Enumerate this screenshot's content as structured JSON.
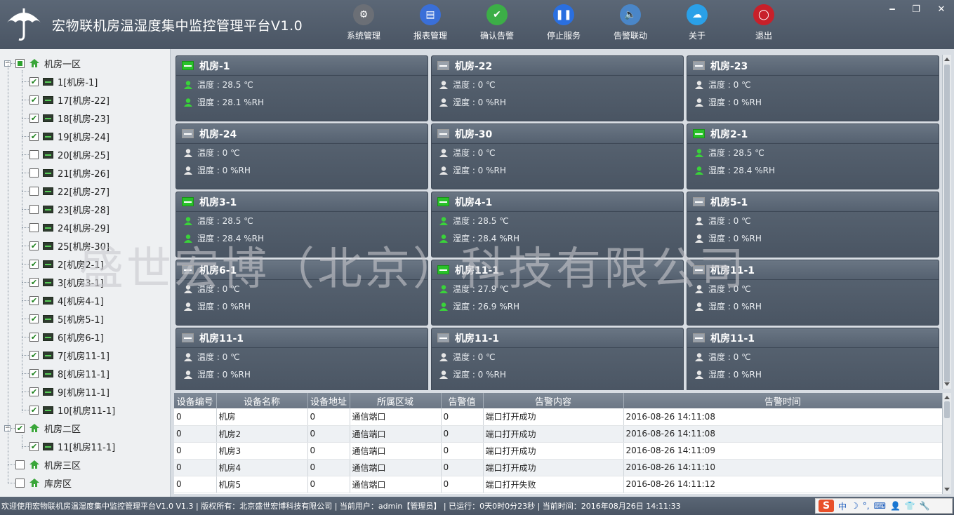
{
  "header": {
    "title": "宏物联机房温湿度集中监控管理平台V1.0",
    "toolbar": [
      {
        "label": "系统管理",
        "icon": "gear-icon",
        "color": "#6b6f76"
      },
      {
        "label": "报表管理",
        "icon": "report-icon",
        "color": "#3a6fd8"
      },
      {
        "label": "确认告警",
        "icon": "check-icon",
        "color": "#3cae47"
      },
      {
        "label": "停止服务",
        "icon": "pause-icon",
        "color": "#2a6fe0"
      },
      {
        "label": "告警联动",
        "icon": "speaker-icon",
        "color": "#4a86c8"
      },
      {
        "label": "关于",
        "icon": "cloud-icon",
        "color": "#2aa0e8"
      },
      {
        "label": "退出",
        "icon": "power-icon",
        "color": "#c8202a"
      }
    ],
    "window_controls": {
      "minimize": "‒",
      "restore": "❐",
      "close": "✕"
    }
  },
  "tree": {
    "groups": [
      {
        "label": "机房一区",
        "state": "partial",
        "children": [
          {
            "label": "1[机房-1]",
            "checked": true
          },
          {
            "label": "17[机房-22]",
            "checked": true
          },
          {
            "label": "18[机房-23]",
            "checked": true
          },
          {
            "label": "19[机房-24]",
            "checked": true
          },
          {
            "label": "20[机房-25]",
            "checked": false
          },
          {
            "label": "21[机房-26]",
            "checked": false
          },
          {
            "label": "22[机房-27]",
            "checked": false
          },
          {
            "label": "23[机房-28]",
            "checked": false
          },
          {
            "label": "24[机房-29]",
            "checked": false
          },
          {
            "label": "25[机房-30]",
            "checked": true
          },
          {
            "label": "2[机房2-1]",
            "checked": true
          },
          {
            "label": "3[机房3-1]",
            "checked": true
          },
          {
            "label": "4[机房4-1]",
            "checked": true
          },
          {
            "label": "5[机房5-1]",
            "checked": true
          },
          {
            "label": "6[机房6-1]",
            "checked": true
          },
          {
            "label": "7[机房11-1]",
            "checked": true
          },
          {
            "label": "8[机房11-1]",
            "checked": true
          },
          {
            "label": "9[机房11-1]",
            "checked": true
          },
          {
            "label": "10[机房11-1]",
            "checked": true
          }
        ]
      },
      {
        "label": "机房二区",
        "state": "checked",
        "children": [
          {
            "label": "11[机房11-1]",
            "checked": true
          }
        ]
      },
      {
        "label": "机房三区",
        "state": "unchecked",
        "children": []
      },
      {
        "label": "库房区",
        "state": "unchecked",
        "children": []
      }
    ]
  },
  "cards": [
    {
      "name": "机房-1",
      "online": true,
      "temp": "温度 : 28.5 ℃",
      "hum": "湿度 : 28.1 %RH"
    },
    {
      "name": "机房-22",
      "online": false,
      "temp": "温度 : 0 ℃",
      "hum": "湿度 : 0 %RH"
    },
    {
      "name": "机房-23",
      "online": false,
      "temp": "温度 : 0 ℃",
      "hum": "湿度 : 0 %RH"
    },
    {
      "name": "机房-24",
      "online": false,
      "temp": "温度 : 0 ℃",
      "hum": "湿度 : 0 %RH"
    },
    {
      "name": "机房-30",
      "online": false,
      "temp": "温度 : 0 ℃",
      "hum": "湿度 : 0 %RH"
    },
    {
      "name": "机房2-1",
      "online": true,
      "temp": "温度 : 28.5 ℃",
      "hum": "湿度 : 28.4 %RH"
    },
    {
      "name": "机房3-1",
      "online": true,
      "temp": "温度 : 28.5 ℃",
      "hum": "湿度 : 28.4 %RH"
    },
    {
      "name": "机房4-1",
      "online": true,
      "temp": "温度 : 28.5 ℃",
      "hum": "湿度 : 28.4 %RH"
    },
    {
      "name": "机房5-1",
      "online": false,
      "temp": "温度 : 0 ℃",
      "hum": "湿度 : 0 %RH"
    },
    {
      "name": "机房6-1",
      "online": false,
      "temp": "温度 : 0 ℃",
      "hum": "湿度 : 0 %RH"
    },
    {
      "name": "机房11-1",
      "online": true,
      "temp": "温度 : 27.9 ℃",
      "hum": "湿度 : 26.9 %RH"
    },
    {
      "name": "机房11-1",
      "online": false,
      "temp": "温度 : 0 ℃",
      "hum": "湿度 : 0 %RH"
    },
    {
      "name": "机房11-1",
      "online": false,
      "temp": "温度 : 0 ℃",
      "hum": "湿度 : 0 %RH"
    },
    {
      "name": "机房11-1",
      "online": false,
      "temp": "温度 : 0 ℃",
      "hum": "湿度 : 0 %RH"
    },
    {
      "name": "机房11-1",
      "online": false,
      "temp": "温度 : 0 ℃",
      "hum": "湿度 : 0 %RH"
    }
  ],
  "watermark": "盛世宏博（北京）科技有限公司",
  "alarms": {
    "columns": [
      "设备编号",
      "设备名称",
      "设备地址",
      "所属区域",
      "告警值",
      "告警内容",
      "告警时间"
    ],
    "rows": [
      [
        "0",
        "机房",
        "0",
        "通信端口",
        "0",
        "端口打开成功",
        "2016-08-26 14:11:08"
      ],
      [
        "0",
        "机房2",
        "0",
        "通信端口",
        "0",
        "端口打开成功",
        "2016-08-26 14:11:08"
      ],
      [
        "0",
        "机房3",
        "0",
        "通信端口",
        "0",
        "端口打开成功",
        "2016-08-26 14:11:09"
      ],
      [
        "0",
        "机房4",
        "0",
        "通信端口",
        "0",
        "端口打开成功",
        "2016-08-26 14:11:10"
      ],
      [
        "0",
        "机房5",
        "0",
        "通信端口",
        "0",
        "端口打开失败",
        "2016-08-26 14:11:12"
      ]
    ]
  },
  "status": {
    "text": "欢迎使用宏物联机房温湿度集中监控管理平台V1.0 V1.3 | 版权所有：北京盛世宏博科技有限公司 | 当前用户：admin【管理员】 | 已运行：0天0时0分23秒 | 当前时间：2016年08月26日 14:11:33"
  },
  "ime": {
    "logo": "S",
    "items": [
      "中",
      "☽",
      "°,",
      "⌨",
      "👤",
      "👕",
      "🔧"
    ]
  },
  "colors": {
    "header": "#52606f",
    "online": "#29c229",
    "offline": "#9aa2ac"
  }
}
